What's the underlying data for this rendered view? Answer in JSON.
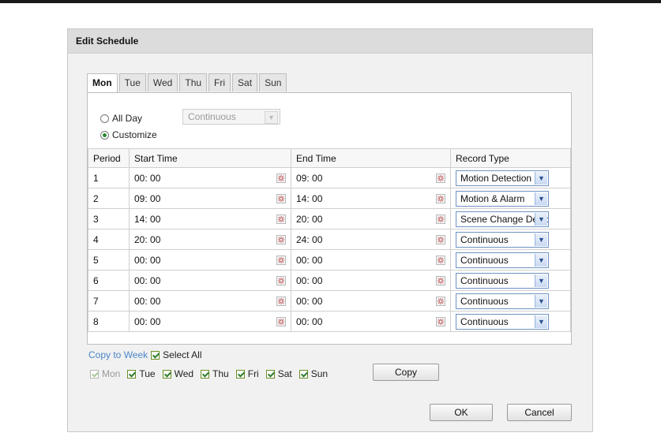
{
  "dialog": {
    "title": "Edit Schedule"
  },
  "tabs": [
    "Mon",
    "Tue",
    "Wed",
    "Thu",
    "Fri",
    "Sat",
    "Sun"
  ],
  "active_tab": "Mon",
  "mode": {
    "all_day_label": "All Day",
    "customize_label": "Customize",
    "selected": "Customize",
    "all_day_type": "Continuous"
  },
  "table": {
    "headers": {
      "period": "Period",
      "start": "Start Time",
      "end": "End Time",
      "record": "Record Type"
    },
    "rows": [
      {
        "period": "1",
        "start": "00: 00",
        "end": "09: 00",
        "record": "Motion Detection"
      },
      {
        "period": "2",
        "start": "09: 00",
        "end": "14: 00",
        "record": "Motion & Alarm"
      },
      {
        "period": "3",
        "start": "14: 00",
        "end": "20: 00",
        "record": "Scene Change Detection"
      },
      {
        "period": "4",
        "start": "20: 00",
        "end": "24: 00",
        "record": "Continuous"
      },
      {
        "period": "5",
        "start": "00: 00",
        "end": "00: 00",
        "record": "Continuous"
      },
      {
        "period": "6",
        "start": "00: 00",
        "end": "00: 00",
        "record": "Continuous"
      },
      {
        "period": "7",
        "start": "00: 00",
        "end": "00: 00",
        "record": "Continuous"
      },
      {
        "period": "8",
        "start": "00: 00",
        "end": "00: 00",
        "record": "Continuous"
      }
    ]
  },
  "copy": {
    "copy_to_week_label": "Copy to Week",
    "select_all_label": "Select All",
    "select_all_checked": true,
    "days": [
      {
        "label": "Mon",
        "checked": true,
        "disabled": true
      },
      {
        "label": "Tue",
        "checked": true,
        "disabled": false
      },
      {
        "label": "Wed",
        "checked": true,
        "disabled": false
      },
      {
        "label": "Thu",
        "checked": true,
        "disabled": false
      },
      {
        "label": "Fri",
        "checked": true,
        "disabled": false
      },
      {
        "label": "Sat",
        "checked": true,
        "disabled": false
      },
      {
        "label": "Sun",
        "checked": true,
        "disabled": false
      }
    ],
    "copy_button": "Copy"
  },
  "buttons": {
    "ok": "OK",
    "cancel": "Cancel"
  },
  "colors": {
    "link": "#4a86c8",
    "check": "#2f7d2f",
    "select_border": "#6f93c2"
  }
}
